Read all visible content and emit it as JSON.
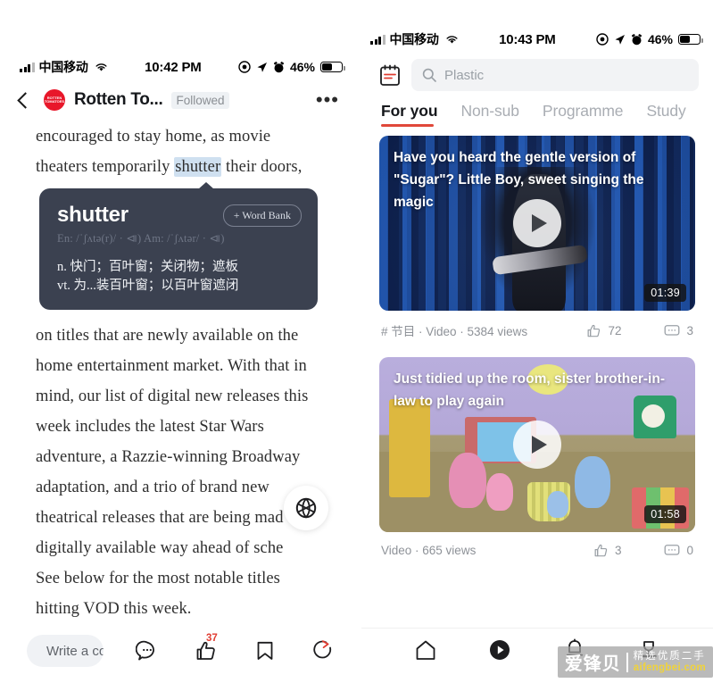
{
  "left": {
    "status": {
      "carrier": "中国移动",
      "time": "10:42 PM",
      "battery_pct": "46%"
    },
    "header": {
      "publisher": "Rotten To...",
      "follow_state": "Followed",
      "more": "•••",
      "logo_text": "ROTTEN TOMATOES"
    },
    "article": {
      "lines_before": [
        "encouraged to stay home, as movie",
        "theaters temporarily ",
        " their doors,"
      ],
      "highlight": "shutter",
      "lines_after": [
        "on titles that are newly available on the",
        "home entertainment market. With that in",
        "mind, our list of digital new releases this",
        "week includes the latest Star Wars",
        "adventure, a Razzie-winning Broadway",
        "adaptation, and a trio of brand new",
        "theatrical releases that are being mad",
        "digitally available way ahead of sche",
        "See below for the most notable titles",
        "hitting VOD this week."
      ]
    },
    "dictionary": {
      "word": "shutter",
      "word_bank_label": "+ Word Bank",
      "phonetics": "En: /ˈʃʌtə(r)/ · ⧏)  Am: /ˈʃʌtər/ · ⧏)",
      "definitions": [
        "n. 快门；百叶窗；关闭物；遮板",
        "vt. 为...装百叶窗；以百叶窗遮闭"
      ]
    },
    "bottom_bar": {
      "comment_placeholder": "Write a comm",
      "like_count": "37"
    },
    "fab_icon": "globe-icon"
  },
  "right": {
    "status": {
      "carrier": "中国移动",
      "time": "10:43 PM",
      "battery_pct": "46%"
    },
    "search": {
      "placeholder": "Plastic"
    },
    "tabs": [
      {
        "label": "For you",
        "active": true
      },
      {
        "label": "Non-sub",
        "active": false
      },
      {
        "label": "Programme",
        "active": false
      },
      {
        "label": "Study",
        "active": false
      }
    ],
    "feed": [
      {
        "title": "Have you heard the gentle version of \"Sugar\"? Little Boy, sweet singing the magic",
        "duration": "01:39",
        "meta": "# 节目 · Video · 5384 views",
        "likes": "72",
        "comments": "3"
      },
      {
        "title": "Just tidied up the room, sister brother-in-law to play again",
        "duration": "01:58",
        "meta": "Video · 665 views",
        "likes": "3",
        "comments": "0"
      }
    ],
    "navbar": [
      {
        "icon": "home-icon",
        "active": false
      },
      {
        "icon": "play-circle-icon",
        "active": true
      },
      {
        "icon": "bell-icon",
        "active": false
      },
      {
        "icon": "profile-icon",
        "active": false
      }
    ]
  },
  "watermark": {
    "brand": "爱锋贝",
    "tagline_cn": "精选优质二手",
    "tagline_en": "aifengbei.com"
  },
  "colors": {
    "accent_red": "#e0483a",
    "logo_red": "#e8172a",
    "dict_bg": "#3b4150",
    "highlight": "#cfe0f0"
  }
}
